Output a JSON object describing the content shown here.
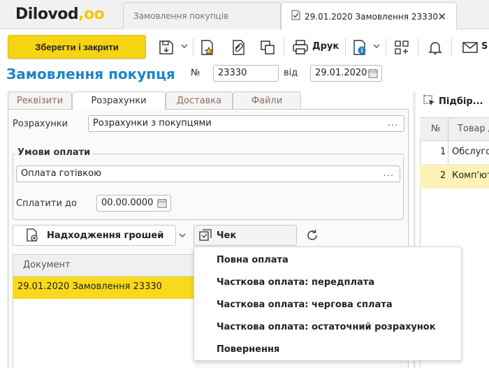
{
  "app": {
    "logo_text": "Dilovod",
    "logo_dots": ",oo"
  },
  "tabs": [
    {
      "label": "Замовлення покупців"
    },
    {
      "label": "29.01.2020 Замовлення 23330",
      "close": "✕"
    }
  ],
  "toolbar": {
    "save_label": "Зберегти і закрити",
    "print_label": "Друк",
    "send_label": "S"
  },
  "document": {
    "title": "Замовлення покупця",
    "number_label": "№",
    "number": "23330",
    "date_label": "від",
    "date": "29.01.2020"
  },
  "inner_tabs": [
    {
      "label": "Реквізити"
    },
    {
      "label": "Розрахунки"
    },
    {
      "label": "Доставка"
    },
    {
      "label": "Файли"
    }
  ],
  "settlements": {
    "label": "Розрахунки",
    "value": "Розрахунки з покупцями",
    "payment_terms_legend": "Умови оплати",
    "payment_method": "Оплата готівкою",
    "pay_until_label": "Сплатити до",
    "pay_until": "00.00.0000"
  },
  "actions": {
    "receipt_label": "Надходження грошей",
    "check_label": "Чек"
  },
  "grid": {
    "column": "Документ",
    "rows": [
      "29.01.2020 Замовлення 23330"
    ]
  },
  "check_menu": [
    "Повна оплата",
    "Часткова оплата: передплата",
    "Часткова оплата: чергова сплата",
    "Часткова оплата: остаточний розрахунок",
    "Повернення"
  ],
  "right_panel": {
    "select_label": "Підбір...",
    "col_no": "№",
    "col_goods": "Товар /",
    "rows": [
      {
        "no": "1",
        "name": "Обслуго"
      },
      {
        "no": "2",
        "name": "Комп'ют"
      }
    ]
  },
  "colors": {
    "accent_yellow": "#f6d313",
    "title_blue": "#1f84c7",
    "row_highlight": "#f8d91c"
  }
}
